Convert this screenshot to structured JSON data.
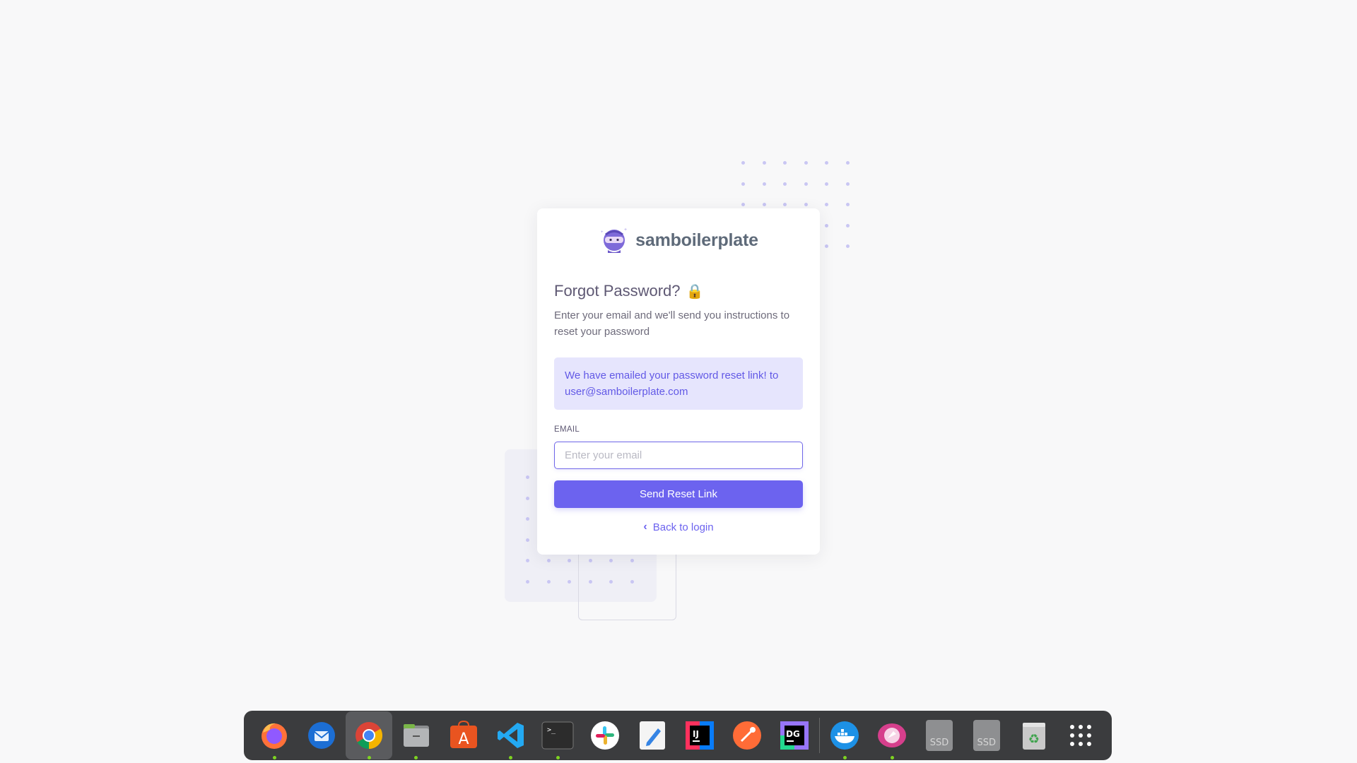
{
  "brand": {
    "name": "samboilerplate"
  },
  "page": {
    "title": "Forgot Password?",
    "title_icon": "🔒",
    "subtitle": "Enter your email and we'll send you instructions to reset your password"
  },
  "alert": {
    "message": "We have emailed your password reset link! to user@samboilerplate.com"
  },
  "form": {
    "email_label": "EMAIL",
    "email_value": "",
    "email_placeholder": "Enter your email",
    "submit_label": "Send Reset Link",
    "back_label": "Back to login"
  },
  "colors": {
    "primary": "#6c63ef",
    "alert_bg": "#e6e5fd",
    "alert_text": "#6259e6"
  },
  "dock": {
    "items": [
      {
        "name": "firefox-icon",
        "running": true
      },
      {
        "name": "thunderbird-icon",
        "running": false
      },
      {
        "name": "chrome-icon",
        "running": true,
        "active": true
      },
      {
        "name": "files-icon",
        "running": true
      },
      {
        "name": "app-store-icon",
        "running": false
      },
      {
        "name": "vscode-icon",
        "running": true
      },
      {
        "name": "terminal-icon",
        "running": true
      },
      {
        "name": "slack-icon",
        "running": false
      },
      {
        "name": "text-editor-icon",
        "running": false
      },
      {
        "name": "intellij-icon",
        "running": false
      },
      {
        "name": "postman-icon",
        "running": false
      },
      {
        "name": "datagrip-icon",
        "running": false
      },
      {
        "name": "docker-icon",
        "running": true
      },
      {
        "name": "compass-icon",
        "running": true
      },
      {
        "name": "ssd-drive-icon",
        "label": "SSD"
      },
      {
        "name": "ssd-drive-icon",
        "label": "SSD"
      },
      {
        "name": "trash-icon"
      },
      {
        "name": "app-grid-icon"
      }
    ]
  }
}
